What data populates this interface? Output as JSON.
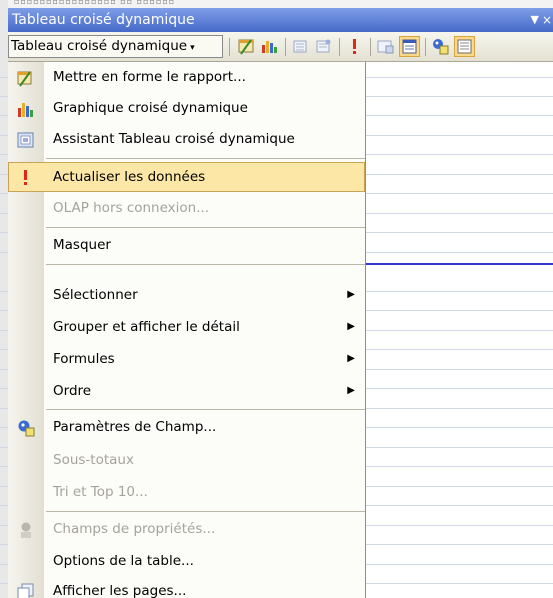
{
  "window": {
    "title": "Tableau croisé dynamique",
    "close_glyph": "×",
    "options_glyph": "▼"
  },
  "toolbar": {
    "menu_label": "Tableau croisé dynamique",
    "menu_caret": "▾",
    "buttons": [
      {
        "icon": "format-report-icon"
      },
      {
        "icon": "pivot-chart-icon"
      },
      {
        "icon": "hide-detail-icon"
      },
      {
        "icon": "show-detail-icon"
      },
      {
        "icon": "refresh-data-icon"
      },
      {
        "icon": "include-hidden-items-icon"
      },
      {
        "icon": "always-display-items-icon",
        "active": true
      },
      {
        "icon": "field-settings-icon"
      },
      {
        "icon": "field-list-icon",
        "active": true
      }
    ]
  },
  "menu": {
    "items": [
      {
        "label": "Mettre en forme le rapport...",
        "icon": "format-report-icon",
        "disabled": false
      },
      {
        "label": "Graphique croisé dynamique",
        "icon": "pivot-chart-icon",
        "disabled": false
      },
      {
        "label": "Assistant Tableau croisé dynamique",
        "icon": "pivot-wizard-icon",
        "disabled": false
      },
      {
        "label": "Actualiser les données",
        "icon": "refresh-data-icon",
        "disabled": false,
        "highlighted": true
      },
      {
        "label": "OLAP hors connexion...",
        "disabled": true
      },
      {
        "label": "Masquer",
        "disabled": false
      },
      {
        "label": "Sélectionner",
        "disabled": false,
        "submenu": true
      },
      {
        "label": "Grouper et afficher le détail",
        "disabled": false,
        "submenu": true
      },
      {
        "label": "Formules",
        "disabled": false,
        "submenu": true
      },
      {
        "label": "Ordre",
        "disabled": false,
        "submenu": true
      },
      {
        "label": "Paramètres de Champ...",
        "icon": "field-settings-icon",
        "disabled": false
      },
      {
        "label": "Sous-totaux",
        "disabled": true
      },
      {
        "label": "Tri et Top 10...",
        "disabled": true
      },
      {
        "label": "Champs de propriétés...",
        "icon": "property-fields-icon",
        "disabled": true
      },
      {
        "label": "Options de la table...",
        "disabled": false
      },
      {
        "label": "Afficher les pages...",
        "icon": "show-pages-icon",
        "disabled": false
      }
    ],
    "submenu_arrow": "▶"
  },
  "colors": {
    "titlebar": "#4569c8",
    "highlight": "#fde7a7",
    "highlight_border": "#c9a455",
    "disabled_text": "#a5a39a",
    "gridline": "#d0d7e5",
    "selection_line": "#2d3bd1"
  }
}
